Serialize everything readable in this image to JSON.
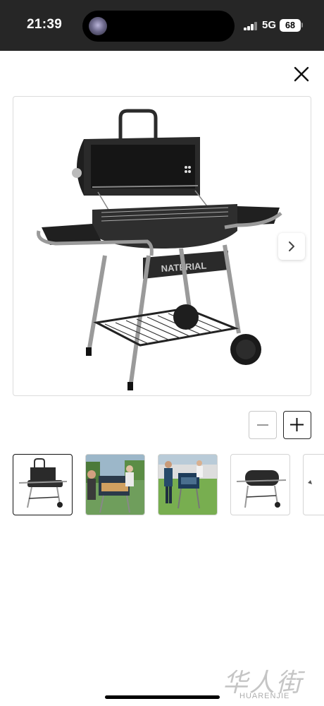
{
  "status_bar": {
    "time": "21:39",
    "network": "5G",
    "battery": "68"
  },
  "product": {
    "brand_label": "NATERIAL"
  },
  "icons": {
    "close": "close-icon",
    "next": "chevron-right-icon",
    "zoom_out": "minus-icon",
    "zoom_in": "plus-icon"
  },
  "gallery": {
    "thumbnails": [
      {
        "label": "grill-front-open",
        "active": true
      },
      {
        "label": "grill-outdoor-cooking"
      },
      {
        "label": "grill-outdoor-party"
      },
      {
        "label": "grill-closed-lid"
      },
      {
        "label": "grill-detail"
      }
    ]
  },
  "watermark": {
    "hanzi": "华人街",
    "text": "HUARENJIE"
  }
}
